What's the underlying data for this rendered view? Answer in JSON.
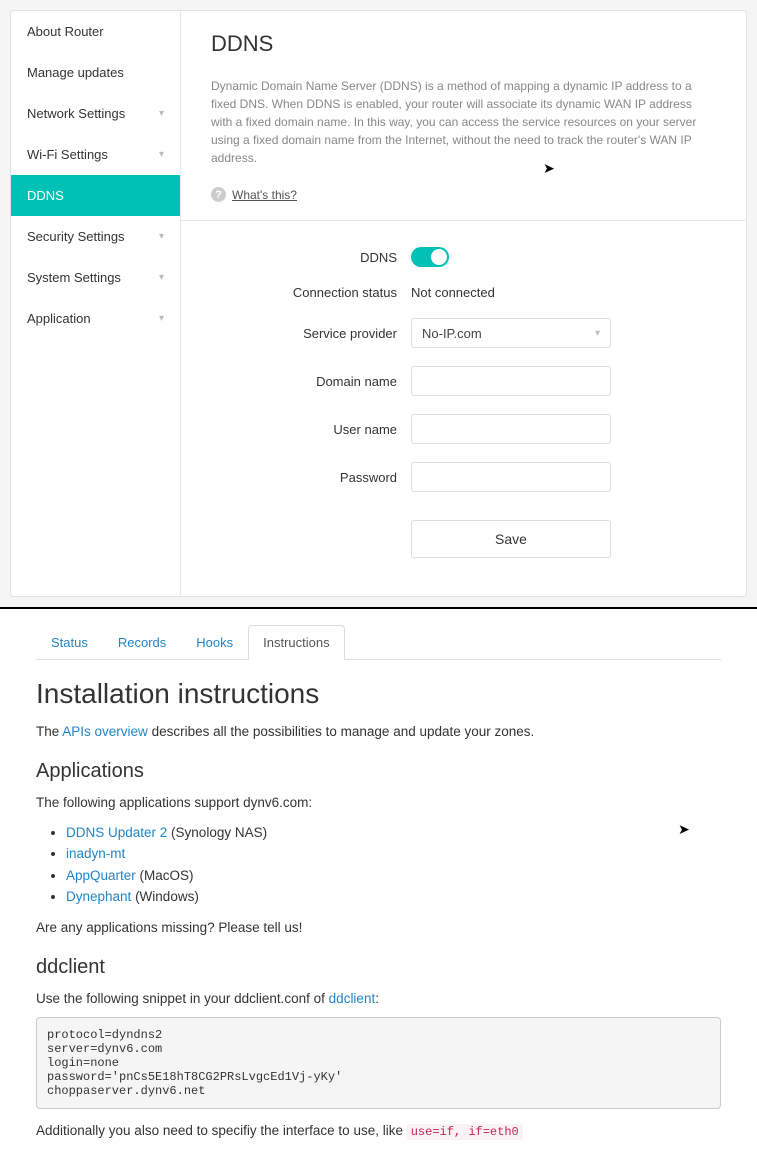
{
  "router": {
    "sidebar": [
      {
        "label": "About Router",
        "expandable": false,
        "active": false
      },
      {
        "label": "Manage updates",
        "expandable": false,
        "active": false
      },
      {
        "label": "Network Settings",
        "expandable": true,
        "active": false
      },
      {
        "label": "Wi-Fi Settings",
        "expandable": true,
        "active": false
      },
      {
        "label": "DDNS",
        "expandable": false,
        "active": true
      },
      {
        "label": "Security Settings",
        "expandable": true,
        "active": false
      },
      {
        "label": "System Settings",
        "expandable": true,
        "active": false
      },
      {
        "label": "Application",
        "expandable": true,
        "active": false
      }
    ],
    "title": "DDNS",
    "description": "Dynamic Domain Name Server (DDNS) is a method of mapping a dynamic IP address to a fixed DNS. When DDNS is enabled, your router will associate its dynamic WAN IP address with a fixed domain name. In this way, you can access the service resources on your server using a fixed domain name from the Internet, without the need to track the router's WAN IP address.",
    "whats_this": "What's this?",
    "form": {
      "ddns_label": "DDNS",
      "connection_status_label": "Connection status",
      "connection_status_value": "Not connected",
      "service_provider_label": "Service provider",
      "service_provider_value": "No-IP.com",
      "domain_name_label": "Domain name",
      "domain_name_value": "",
      "user_name_label": "User name",
      "user_name_value": "",
      "password_label": "Password",
      "password_value": "",
      "save_label": "Save"
    }
  },
  "docs": {
    "tabs": [
      {
        "label": "Status",
        "active": false
      },
      {
        "label": "Records",
        "active": false
      },
      {
        "label": "Hooks",
        "active": false
      },
      {
        "label": "Instructions",
        "active": true
      }
    ],
    "h1": "Installation instructions",
    "intro_pre": "The ",
    "intro_link": "APIs overview",
    "intro_post": " describes all the possibilities to manage and update your zones.",
    "h2_apps": "Applications",
    "apps_intro": "The following applications support dynv6.com:",
    "apps": [
      {
        "link": "DDNS Updater 2",
        "suffix": " (Synology NAS)"
      },
      {
        "link": "inadyn-mt",
        "suffix": ""
      },
      {
        "link": "AppQuarter",
        "suffix": " (MacOS)"
      },
      {
        "link": "Dynephant",
        "suffix": " (Windows)"
      }
    ],
    "missing": "Are any applications missing? Please tell us!",
    "h2_ddclient": "ddclient",
    "dd_intro_pre": "Use the following snippet in your ddclient.conf of ",
    "dd_intro_link": "ddclient",
    "dd_intro_post": ":",
    "codeblock": "protocol=dyndns2\nserver=dynv6.com\nlogin=none\npassword='pnCs5E18hT8CG2PRsLvgcEd1Vj-yKy'\nchoppaserver.dynv6.net",
    "additional_pre": "Additionally you also need to specifiy the interface to use, like ",
    "additional_code": "use=if, if=eth0"
  }
}
